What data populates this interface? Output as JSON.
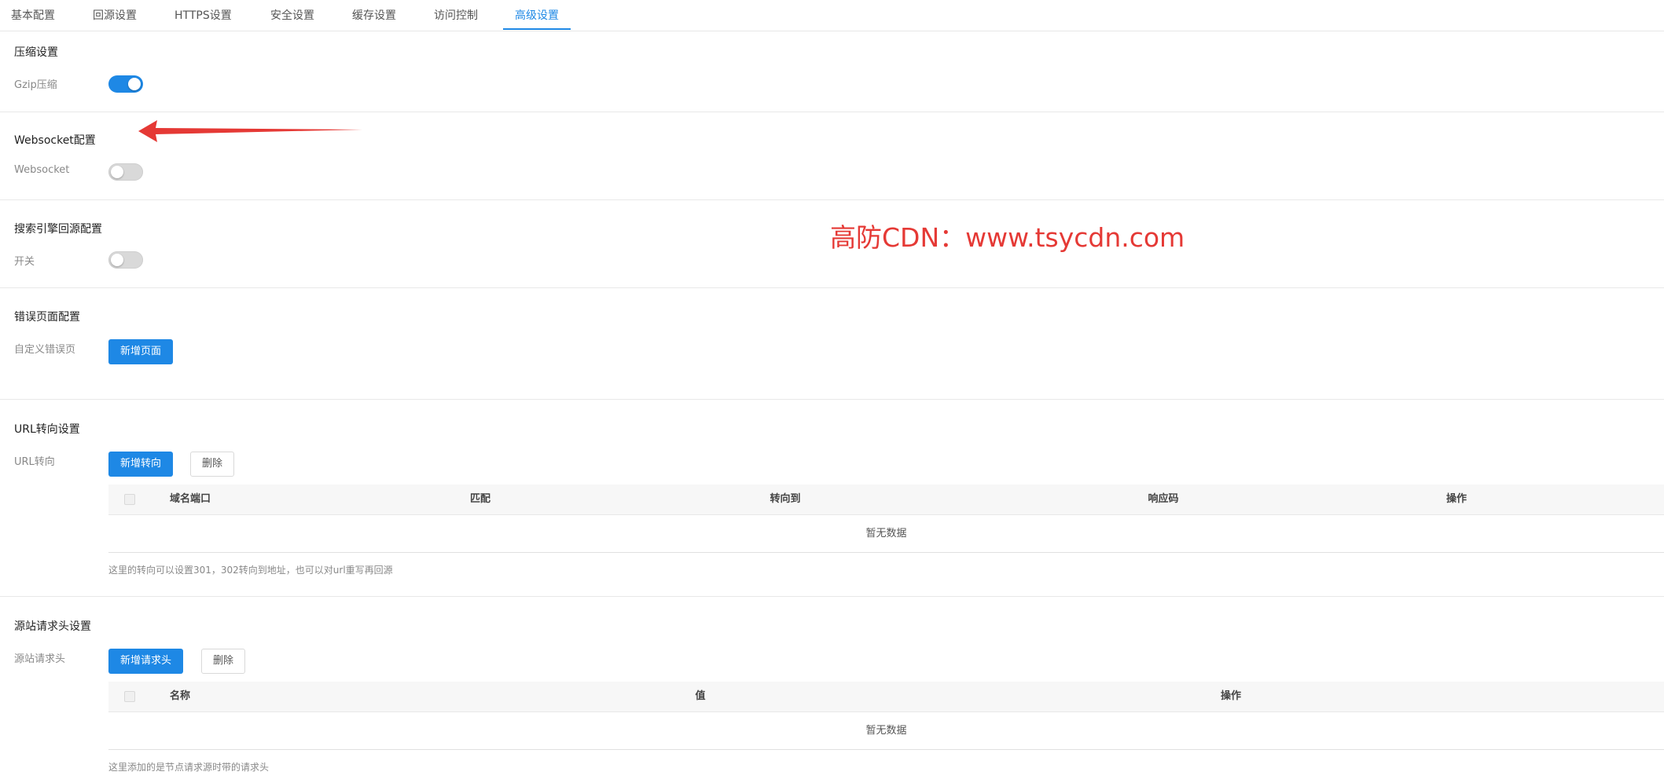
{
  "tabs": [
    "基本配置",
    "回源设置",
    "HTTPS设置",
    "安全设置",
    "缓存设置",
    "访问控制",
    "高级设置"
  ],
  "active_tab": "高级设置",
  "compression": {
    "title": "压缩设置",
    "gzip_label": "Gzip压缩",
    "gzip_enabled": true
  },
  "websocket": {
    "title": "Websocket配置",
    "label": "Websocket",
    "enabled": false
  },
  "search_engine": {
    "title": "搜索引擎回源配置",
    "label": "开关",
    "enabled": false
  },
  "error_page": {
    "title": "错误页面配置",
    "label": "自定义错误页",
    "add_button": "新增页面"
  },
  "url_redirect": {
    "title": "URL转向设置",
    "label": "URL转向",
    "add_button": "新增转向",
    "delete_button": "删除",
    "columns": [
      "域名端口",
      "匹配",
      "转向到",
      "响应码",
      "操作"
    ],
    "empty_text": "暂无数据",
    "hint": "这里的转向可以设置301，302转向到地址，也可以对url重写再回源"
  },
  "origin_headers": {
    "title": "源站请求头设置",
    "label": "源站请求头",
    "add_button": "新增请求头",
    "delete_button": "删除",
    "columns": [
      "名称",
      "值",
      "操作"
    ],
    "empty_text": "暂无数据",
    "hint": "这里添加的是节点请求源时带的请求头"
  },
  "watermark": "高防CDN：www.tsycdn.com",
  "colors": {
    "accent": "#1e88e5",
    "watermark": "#e53935"
  }
}
